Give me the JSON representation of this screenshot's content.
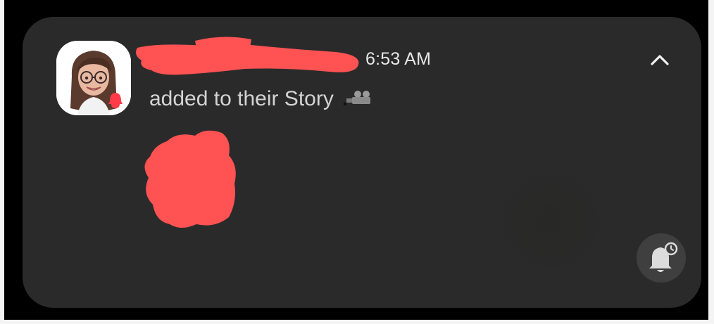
{
  "notification": {
    "time": "6:53 AM",
    "message": "added to their Story",
    "sender_redacted": true,
    "image_redacted": true,
    "icons": {
      "avatar": "bitmoji-avatar",
      "app_badge": "snapchat-ghost-icon",
      "collapse": "chevron-up-icon",
      "story_emoji": "film-camera-icon",
      "snooze": "bell-snooze-icon"
    }
  },
  "colors": {
    "background": "#000000",
    "card": "#2a2a2b",
    "text_primary": "#e6e6e6",
    "text_secondary": "#d4d4d4",
    "redaction": "#ff5252",
    "snooze_button": "#3f3f40",
    "badge": "#ff3b4a"
  }
}
